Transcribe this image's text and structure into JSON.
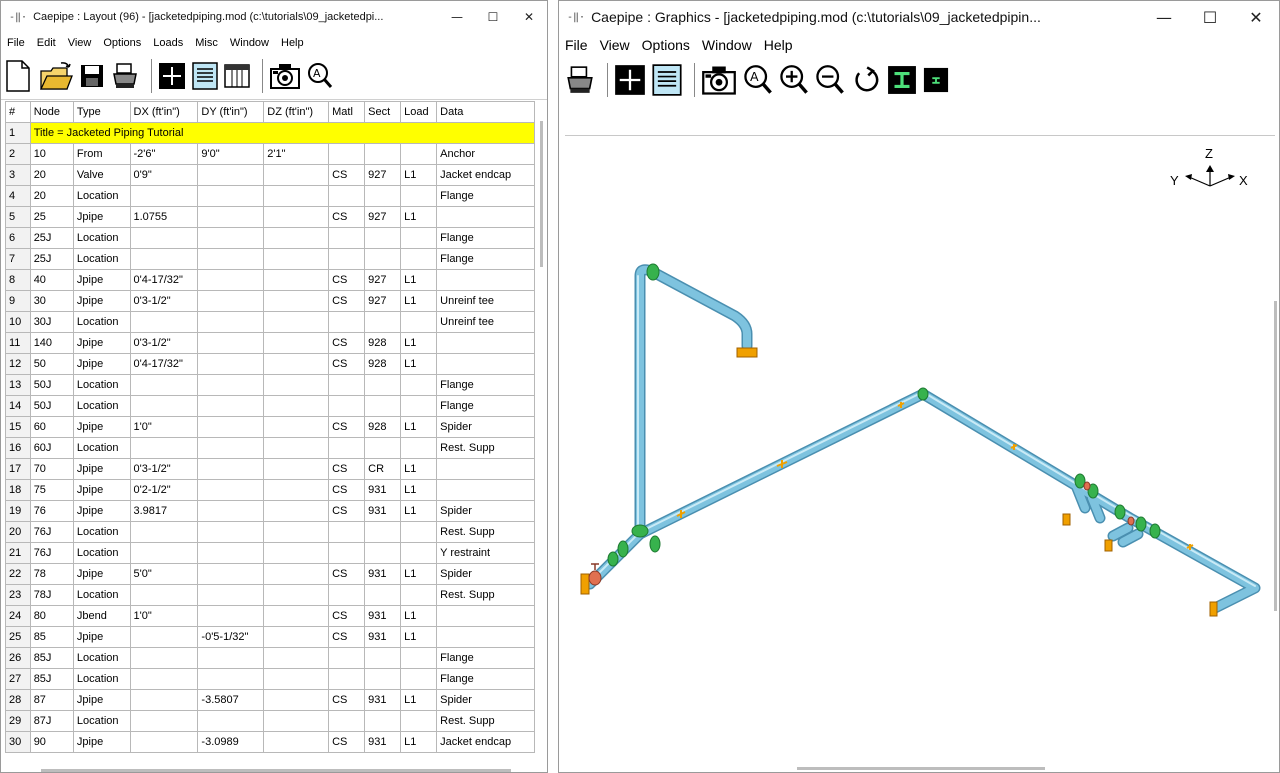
{
  "left_window": {
    "title": "Caepipe : Layout  (96)  -  [jacketedpiping.mod (c:\\tutorials\\09_jacketedpi...",
    "menu": [
      "File",
      "Edit",
      "View",
      "Options",
      "Loads",
      "Misc",
      "Window",
      "Help"
    ],
    "columns": [
      "#",
      "Node",
      "Type",
      "DX (ft'in\")",
      "DY (ft'in\")",
      "DZ (ft'in\")",
      "Matl",
      "Sect",
      "Load",
      "Data"
    ],
    "title_row": {
      "num": "1",
      "text": "Title = Jacketed Piping Tutorial"
    },
    "rows": [
      {
        "num": "2",
        "node": "10",
        "type": "From",
        "dx": "-2'6\"",
        "dy": "9'0\"",
        "dz": "2'1\"",
        "matl": "",
        "sect": "",
        "load": "",
        "data": "Anchor"
      },
      {
        "num": "3",
        "node": "20",
        "type": "Valve",
        "dx": "0'9\"",
        "dy": "",
        "dz": "",
        "matl": "CS",
        "sect": "927",
        "load": "L1",
        "data": "Jacket endcap"
      },
      {
        "num": "4",
        "node": "20",
        "type": "Location",
        "dx": "",
        "dy": "",
        "dz": "",
        "matl": "",
        "sect": "",
        "load": "",
        "data": "Flange"
      },
      {
        "num": "5",
        "node": "25",
        "type": "Jpipe",
        "dx": "1.0755",
        "dy": "",
        "dz": "",
        "matl": "CS",
        "sect": "927",
        "load": "L1",
        "data": ""
      },
      {
        "num": "6",
        "node": "25J",
        "type": "Location",
        "dx": "",
        "dy": "",
        "dz": "",
        "matl": "",
        "sect": "",
        "load": "",
        "data": "Flange"
      },
      {
        "num": "7",
        "node": "25J",
        "type": "Location",
        "dx": "",
        "dy": "",
        "dz": "",
        "matl": "",
        "sect": "",
        "load": "",
        "data": "Flange"
      },
      {
        "num": "8",
        "node": "40",
        "type": "Jpipe",
        "dx": "0'4-17/32\"",
        "dy": "",
        "dz": "",
        "matl": "CS",
        "sect": "927",
        "load": "L1",
        "data": ""
      },
      {
        "num": "9",
        "node": "30",
        "type": "Jpipe",
        "dx": "0'3-1/2\"",
        "dy": "",
        "dz": "",
        "matl": "CS",
        "sect": "927",
        "load": "L1",
        "data": "Unreinf tee"
      },
      {
        "num": "10",
        "node": "30J",
        "type": "Location",
        "dx": "",
        "dy": "",
        "dz": "",
        "matl": "",
        "sect": "",
        "load": "",
        "data": "Unreinf tee"
      },
      {
        "num": "11",
        "node": "140",
        "type": "Jpipe",
        "dx": "0'3-1/2\"",
        "dy": "",
        "dz": "",
        "matl": "CS",
        "sect": "928",
        "load": "L1",
        "data": ""
      },
      {
        "num": "12",
        "node": "50",
        "type": "Jpipe",
        "dx": "0'4-17/32\"",
        "dy": "",
        "dz": "",
        "matl": "CS",
        "sect": "928",
        "load": "L1",
        "data": ""
      },
      {
        "num": "13",
        "node": "50J",
        "type": "Location",
        "dx": "",
        "dy": "",
        "dz": "",
        "matl": "",
        "sect": "",
        "load": "",
        "data": "Flange"
      },
      {
        "num": "14",
        "node": "50J",
        "type": "Location",
        "dx": "",
        "dy": "",
        "dz": "",
        "matl": "",
        "sect": "",
        "load": "",
        "data": "Flange"
      },
      {
        "num": "15",
        "node": "60",
        "type": "Jpipe",
        "dx": "1'0\"",
        "dy": "",
        "dz": "",
        "matl": "CS",
        "sect": "928",
        "load": "L1",
        "data": "Spider"
      },
      {
        "num": "16",
        "node": "60J",
        "type": "Location",
        "dx": "",
        "dy": "",
        "dz": "",
        "matl": "",
        "sect": "",
        "load": "",
        "data": "Rest. Supp"
      },
      {
        "num": "17",
        "node": "70",
        "type": "Jpipe",
        "dx": "0'3-1/2\"",
        "dy": "",
        "dz": "",
        "matl": "CS",
        "sect": "CR",
        "load": "L1",
        "data": ""
      },
      {
        "num": "18",
        "node": "75",
        "type": "Jpipe",
        "dx": "0'2-1/2\"",
        "dy": "",
        "dz": "",
        "matl": "CS",
        "sect": "931",
        "load": "L1",
        "data": ""
      },
      {
        "num": "19",
        "node": "76",
        "type": "Jpipe",
        "dx": "3.9817",
        "dy": "",
        "dz": "",
        "matl": "CS",
        "sect": "931",
        "load": "L1",
        "data": "Spider"
      },
      {
        "num": "20",
        "node": "76J",
        "type": "Location",
        "dx": "",
        "dy": "",
        "dz": "",
        "matl": "",
        "sect": "",
        "load": "",
        "data": "Rest. Supp"
      },
      {
        "num": "21",
        "node": "76J",
        "type": "Location",
        "dx": "",
        "dy": "",
        "dz": "",
        "matl": "",
        "sect": "",
        "load": "",
        "data": "Y restraint"
      },
      {
        "num": "22",
        "node": "78",
        "type": "Jpipe",
        "dx": "5'0\"",
        "dy": "",
        "dz": "",
        "matl": "CS",
        "sect": "931",
        "load": "L1",
        "data": "Spider"
      },
      {
        "num": "23",
        "node": "78J",
        "type": "Location",
        "dx": "",
        "dy": "",
        "dz": "",
        "matl": "",
        "sect": "",
        "load": "",
        "data": "Rest. Supp"
      },
      {
        "num": "24",
        "node": "80",
        "type": "Jbend",
        "dx": "1'0\"",
        "dy": "",
        "dz": "",
        "matl": "CS",
        "sect": "931",
        "load": "L1",
        "data": ""
      },
      {
        "num": "25",
        "node": "85",
        "type": "Jpipe",
        "dx": "",
        "dy": "-0'5-1/32\"",
        "dz": "",
        "matl": "CS",
        "sect": "931",
        "load": "L1",
        "data": ""
      },
      {
        "num": "26",
        "node": "85J",
        "type": "Location",
        "dx": "",
        "dy": "",
        "dz": "",
        "matl": "",
        "sect": "",
        "load": "",
        "data": "Flange"
      },
      {
        "num": "27",
        "node": "85J",
        "type": "Location",
        "dx": "",
        "dy": "",
        "dz": "",
        "matl": "",
        "sect": "",
        "load": "",
        "data": "Flange"
      },
      {
        "num": "28",
        "node": "87",
        "type": "Jpipe",
        "dx": "",
        "dy": "-3.5807",
        "dz": "",
        "matl": "CS",
        "sect": "931",
        "load": "L1",
        "data": "Spider"
      },
      {
        "num": "29",
        "node": "87J",
        "type": "Location",
        "dx": "",
        "dy": "",
        "dz": "",
        "matl": "",
        "sect": "",
        "load": "",
        "data": "Rest. Supp"
      },
      {
        "num": "30",
        "node": "90",
        "type": "Jpipe",
        "dx": "",
        "dy": "-3.0989",
        "dz": "",
        "matl": "CS",
        "sect": "931",
        "load": "L1",
        "data": "Jacket endcap"
      }
    ],
    "toolbar_icons": [
      "new-file-icon",
      "open-folder-icon",
      "save-icon",
      "print-icon",
      "graphics-cross-icon",
      "list-icon",
      "columns-icon",
      "camera-icon",
      "zoom-a-icon"
    ]
  },
  "right_window": {
    "title": "Caepipe : Graphics -  [jacketedpiping.mod (c:\\tutorials\\09_jacketedpipin...",
    "menu": [
      "File",
      "View",
      "Options",
      "Window",
      "Help"
    ],
    "toolbar_icons": [
      "print-icon",
      "layout-cross-icon",
      "list-icon",
      "camera-icon",
      "zoom-auto-icon",
      "zoom-in-icon",
      "zoom-out-icon",
      "rotate-icon",
      "section-icon",
      "small-section-icon"
    ],
    "axes": {
      "z": "Z",
      "y": "Y",
      "x": "X"
    },
    "colors": {
      "pipe": "#7ec3df",
      "pipe_dark": "#4a8fb0",
      "flange": "#37b24d",
      "support": "#f0a000",
      "valve": "#e07050"
    }
  },
  "window_controls": {
    "minimize": "—",
    "maximize": "☐",
    "close": "✕"
  }
}
